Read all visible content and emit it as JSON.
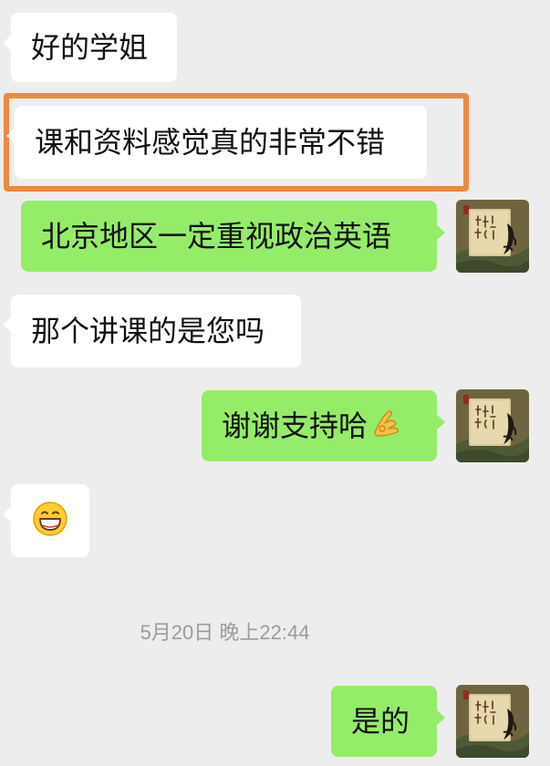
{
  "messages": [
    {
      "id": "m1",
      "side": "incoming",
      "text": "好的学姐"
    },
    {
      "id": "m2",
      "side": "incoming",
      "text": "课和资料感觉真的非常不错",
      "highlighted": true
    },
    {
      "id": "m3",
      "side": "outgoing",
      "text": "北京地区一定重视政治英语"
    },
    {
      "id": "m4",
      "side": "incoming",
      "text": "那个讲课的是您吗"
    },
    {
      "id": "m5",
      "side": "outgoing",
      "text": "谢谢支持哈",
      "emoji": "ok-hand-emoji"
    },
    {
      "id": "m6",
      "side": "incoming",
      "text": "",
      "emoji": "grinning-face-emoji"
    },
    {
      "id": "m7",
      "side": "outgoing",
      "text": "是的"
    }
  ],
  "timestamp": "5月20日 晚上22:44",
  "colors": {
    "background": "#ededed",
    "incoming_bubble": "#ffffff",
    "outgoing_bubble": "#95ec69",
    "highlight_border": "#f0883e",
    "timestamp_text": "#9b9b9b"
  },
  "avatar": {
    "icon": "calligraphy-painting-avatar"
  }
}
